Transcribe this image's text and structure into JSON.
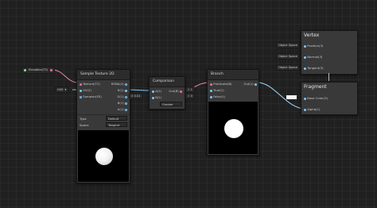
{
  "colors": {
    "bg": "#202020",
    "node": "#393939",
    "header": "#2c2c2c",
    "vector": "#7fc8ff",
    "boolean": "#f0709c",
    "float": "#90e090"
  },
  "exposed_property": {
    "label": "Elevation(T2)"
  },
  "sample_texture": {
    "title": "Sample Texture 2D",
    "inputs": [
      "Texture(T2)",
      "UV(2)",
      "Sampler(SS)"
    ],
    "outputs": [
      "RGBA(4)",
      "R(1)",
      "G(1)",
      "B(1)",
      "A(1)"
    ],
    "uv_field": "UV0",
    "type_label": "Type",
    "type_value": "Default",
    "space_label": "Space",
    "space_value": "Tangent"
  },
  "comparison": {
    "title": "Comparison",
    "inputs": [
      "A(1)",
      "B(1)"
    ],
    "output": "Out(B)",
    "b_value": "0.01",
    "mode": "Greater"
  },
  "branch": {
    "title": "Branch",
    "inputs": [
      "Predicate(B)",
      "True(1)",
      "False(1)"
    ],
    "true_value": "1",
    "false_value": "0",
    "output": "Out(1)"
  },
  "vertex": {
    "title": "Vertex",
    "ports": [
      {
        "space": "Object Space",
        "label": "Position(3)"
      },
      {
        "space": "Object Space",
        "label": "Normal(3)"
      },
      {
        "space": "Object Space",
        "label": "Tangent(3)"
      }
    ]
  },
  "fragment": {
    "title": "Fragment",
    "ports": [
      {
        "label": "Base Color(3)"
      },
      {
        "label": "Alpha(1)"
      }
    ]
  }
}
